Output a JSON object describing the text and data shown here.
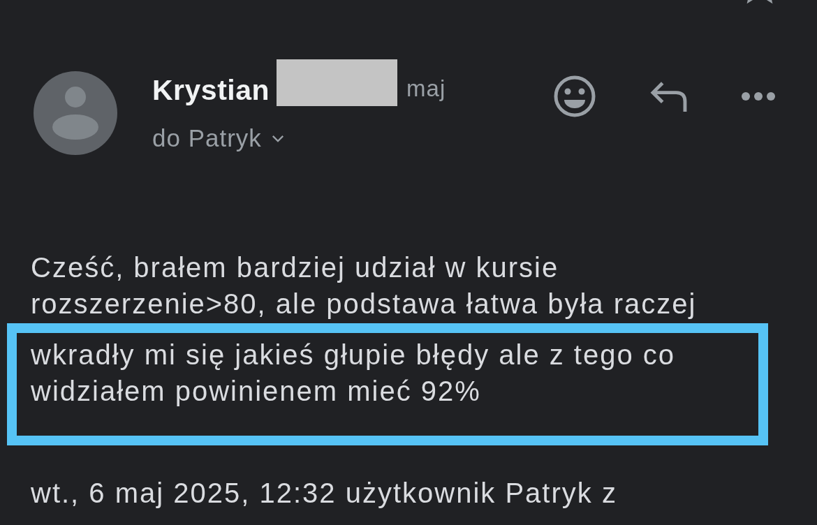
{
  "message": {
    "sender": {
      "name": "Krystian",
      "redacted_surname": true
    },
    "date": "maj",
    "recipient": {
      "label": "do Patryk",
      "expanded": false
    },
    "actions": [
      {
        "kind": "react"
      },
      {
        "kind": "reply"
      },
      {
        "kind": "more"
      }
    ],
    "body": {
      "text": "Cześć, brałem bardziej udział w kursie rozszerzenie>80, ale podstawa łatwa była raczej"
    },
    "highlight": {
      "text": "wkradły mi się jakieś głupie błędy ale z tego co widziałem powinienem mieć 92%"
    },
    "quote_header": "wt., 6 maj 2025, 12:32 użytkownik Patryk z"
  }
}
